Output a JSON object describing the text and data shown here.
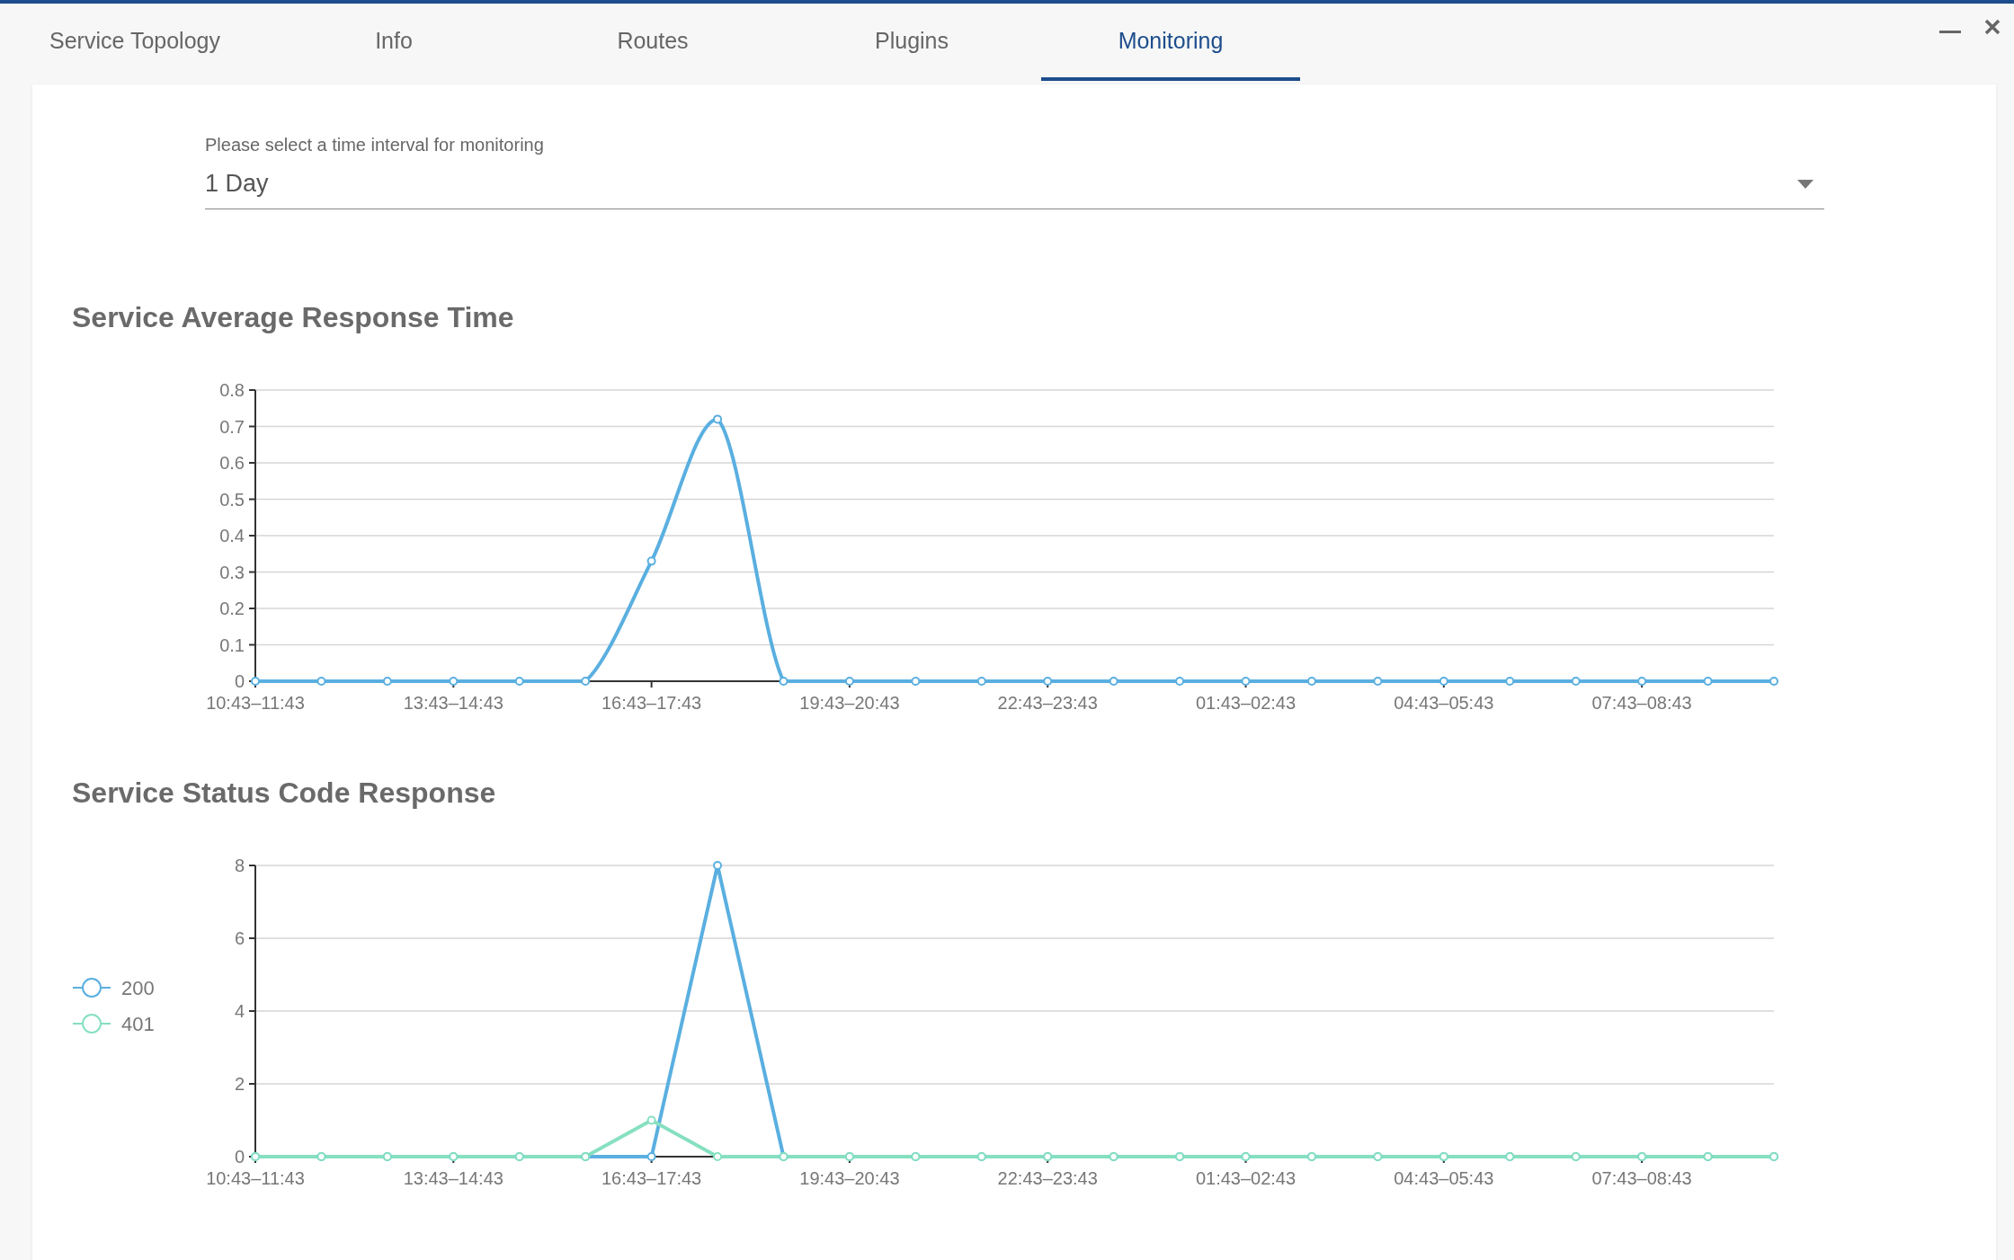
{
  "tabs": [
    {
      "label": "Service Topology",
      "selected": false
    },
    {
      "label": "Info",
      "selected": false
    },
    {
      "label": "Routes",
      "selected": false
    },
    {
      "label": "Plugins",
      "selected": false
    },
    {
      "label": "Monitoring",
      "selected": true
    }
  ],
  "interval_select": {
    "label": "Please select a time interval for monitoring",
    "value": "1 Day"
  },
  "charts": [
    {
      "title": "Service Average Response Time",
      "smooth": true,
      "chart_data": {
        "type": "line",
        "categories": [
          "10:43–11:43",
          null,
          null,
          "13:43–14:43",
          null,
          null,
          "16:43–17:43",
          null,
          null,
          "19:43–20:43",
          null,
          null,
          "22:43–23:43",
          null,
          null,
          "01:43–02:43",
          null,
          null,
          "04:43–05:43",
          null,
          null,
          "07:43–08:43",
          null,
          null
        ],
        "grid": true,
        "marker": "circle",
        "ylim": [
          0,
          0.8
        ],
        "yticks": [
          0,
          0.1,
          0.2,
          0.3,
          0.4,
          0.5,
          0.6,
          0.7,
          0.8
        ],
        "values": [
          0,
          0,
          0,
          0,
          0,
          0,
          0.33,
          0.72,
          0,
          0,
          0,
          0,
          0,
          0,
          0,
          0,
          0,
          0,
          0,
          0,
          0,
          0,
          0,
          0
        ]
      }
    },
    {
      "title": "Service Status Code Response",
      "smooth": false,
      "chart_data": {
        "type": "line",
        "categories": [
          "10:43–11:43",
          null,
          null,
          "13:43–14:43",
          null,
          null,
          "16:43–17:43",
          null,
          null,
          "19:43–20:43",
          null,
          null,
          "22:43–23:43",
          null,
          null,
          "01:43–02:43",
          null,
          null,
          "04:43–05:43",
          null,
          null,
          "07:43–08:43",
          null,
          null
        ],
        "grid": true,
        "legend": "left",
        "ylim": [
          0,
          8
        ],
        "yticks": [
          0,
          2,
          4,
          6,
          8
        ],
        "series": [
          {
            "name": "200",
            "color": "#5aafe0",
            "marker": "circle",
            "values": [
              0,
              0,
              0,
              0,
              0,
              0,
              0,
              8,
              0,
              0,
              0,
              0,
              0,
              0,
              0,
              0,
              0,
              0,
              0,
              0,
              0,
              0,
              0,
              0
            ]
          },
          {
            "name": "401",
            "color": "#86e0c0",
            "marker": "circle",
            "values": [
              0,
              0,
              0,
              0,
              0,
              0,
              1,
              0,
              0,
              0,
              0,
              0,
              0,
              0,
              0,
              0,
              0,
              0,
              0,
              0,
              0,
              0,
              0,
              0
            ]
          }
        ]
      }
    }
  ]
}
